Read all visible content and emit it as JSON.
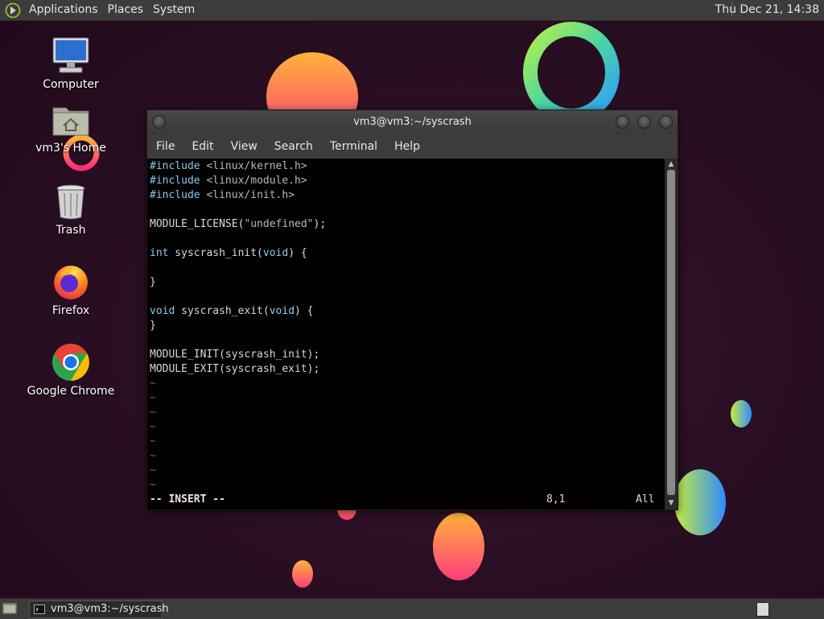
{
  "top_panel": {
    "menus": [
      "Applications",
      "Places",
      "System"
    ],
    "clock": "Thu Dec 21, 14:38"
  },
  "desktop": {
    "icons": [
      {
        "label": "Computer",
        "icon": "computer-icon"
      },
      {
        "label": "vm3's Home",
        "icon": "home-folder-icon"
      },
      {
        "label": "Trash",
        "icon": "trash-icon"
      },
      {
        "label": "Firefox",
        "icon": "firefox-icon"
      },
      {
        "label": "Google Chrome",
        "icon": "chrome-icon"
      }
    ]
  },
  "terminal": {
    "title": "vm3@vm3:~/syscrash",
    "menus": [
      "File",
      "Edit",
      "View",
      "Search",
      "Terminal",
      "Help"
    ],
    "lines": [
      {
        "a": "#include ",
        "b": "<linux/kernel.h>"
      },
      {
        "a": "#include ",
        "b": "<linux/module.h>"
      },
      {
        "a": "#include ",
        "b": "<linux/init.h>"
      },
      {
        "a": "",
        "b": ""
      },
      {
        "a": "MODULE_LICENSE(",
        "b": "\"undefined\"",
        "c": ");"
      },
      {
        "a": "",
        "b": ""
      },
      {
        "a": "int",
        "b": " syscrash_init(",
        "c": "void",
        "d": ") {"
      },
      {
        "a": "",
        "b": ""
      },
      {
        "a": "}",
        "b": ""
      },
      {
        "a": "",
        "b": ""
      },
      {
        "a": "void",
        "b": " syscrash_exit(",
        "c": "void",
        "d": ") {"
      },
      {
        "a": "}",
        "b": ""
      },
      {
        "a": "",
        "b": ""
      },
      {
        "a": "MODULE_INIT(syscrash_init);",
        "b": ""
      },
      {
        "a": "MODULE_EXIT(syscrash_exit);",
        "b": ""
      }
    ],
    "tilde": "~",
    "status": {
      "mode": "-- INSERT --",
      "position": "8,1",
      "scroll": "All"
    }
  },
  "taskbar": {
    "task_label": "vm3@vm3:~/syscrash"
  }
}
